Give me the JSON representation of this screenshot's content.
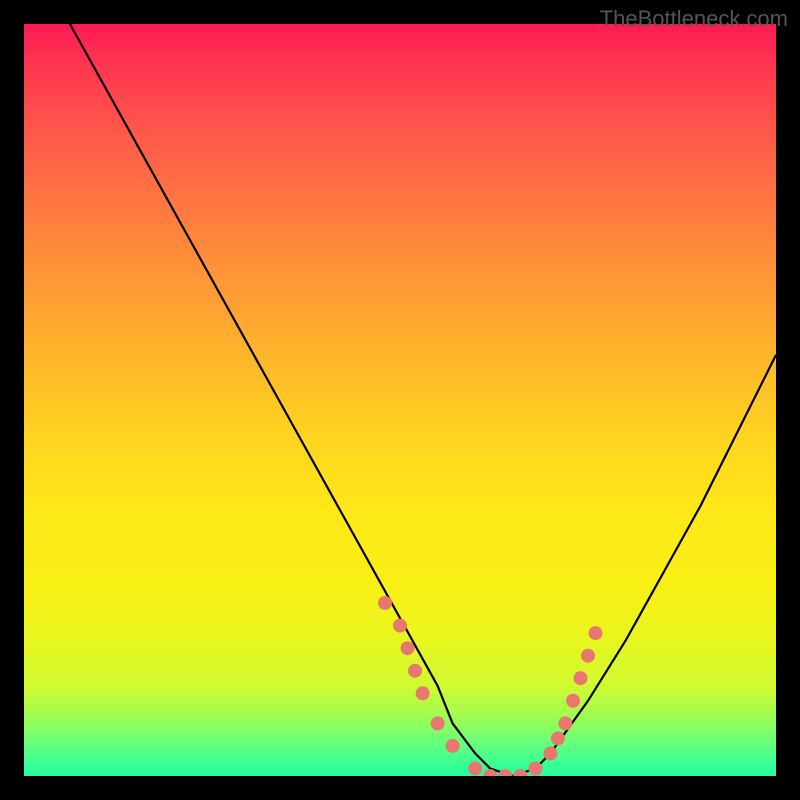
{
  "watermark": "TheBottleneck.com",
  "chart_data": {
    "type": "line",
    "title": "",
    "xlabel": "",
    "ylabel": "",
    "xlim": [
      0,
      100
    ],
    "ylim": [
      0,
      100
    ],
    "x": [
      0,
      5,
      10,
      15,
      20,
      25,
      30,
      35,
      40,
      45,
      50,
      55,
      57,
      60,
      62,
      65,
      68,
      70,
      75,
      80,
      85,
      90,
      95,
      100
    ],
    "values": [
      110,
      102,
      93,
      84,
      75,
      66,
      57,
      48,
      39,
      30,
      21,
      12,
      7,
      3,
      1,
      0,
      1,
      3,
      10,
      18,
      27,
      36,
      46,
      56
    ],
    "scatter_overlay": {
      "x": [
        48,
        50,
        51,
        52,
        53,
        55,
        57,
        60,
        62,
        64,
        66,
        68,
        70,
        71,
        72,
        73,
        74,
        75,
        76
      ],
      "y": [
        23,
        20,
        17,
        14,
        11,
        7,
        4,
        1,
        0,
        0,
        0,
        1,
        3,
        5,
        7,
        10,
        13,
        16,
        19
      ]
    },
    "gradient_colors": [
      "#ff1a55",
      "#ff7a40",
      "#ffd41f",
      "#e8f620",
      "#20ffa0"
    ]
  }
}
